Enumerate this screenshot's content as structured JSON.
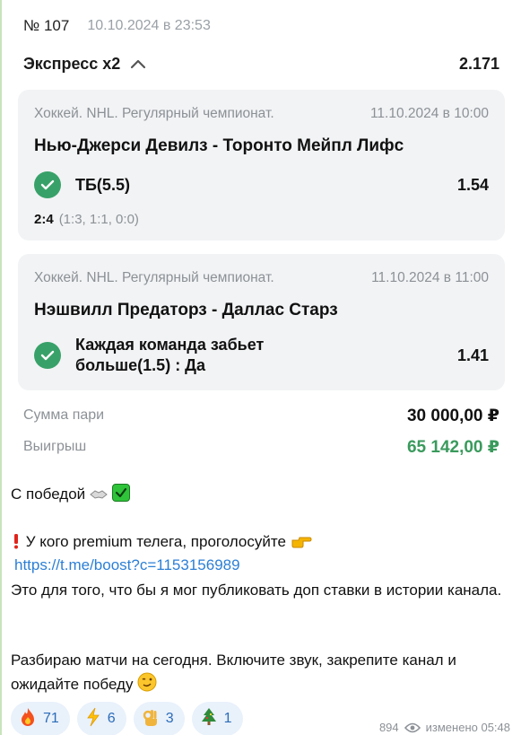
{
  "bet": {
    "number": "№ 107",
    "datetime": "10.10.2024 в 23:53",
    "type": "Экспресс х2",
    "total_odds": "2.171",
    "legs": [
      {
        "league": "Хоккей. NHL. Регулярный чемпионат.",
        "datetime": "11.10.2024 в 10:00",
        "match": "Нью-Джерси Девилз - Торонто Мейпл Лифс",
        "pick": "ТБ(5.5)",
        "odds": "1.54",
        "score": "2:4",
        "periods": "(1:3, 1:1, 0:0)",
        "status": "won"
      },
      {
        "league": "Хоккей. NHL. Регулярный чемпионат.",
        "datetime": "11.10.2024 в 11:00",
        "match": "Нэшвилл Предаторз - Даллас Старз",
        "pick": "Каждая команда забьет больше(1.5) : Да",
        "odds": "1.41",
        "status": "won"
      }
    ],
    "stake_label": "Сумма пари",
    "stake_value": "30 000,00 ₽",
    "win_label": "Выигрыш",
    "win_value": "65 142,00 ₽"
  },
  "message": {
    "line1": "С победой",
    "line2": "У кого premium телега, проголосуйте",
    "link": "https://t.me/boost?c=1153156989",
    "line3": "Это для того, что бы я мог публиковать доп ставки в истории канала.",
    "line4": "Разбираю матчи на сегодня. Включите звук, закрепите канал и ожидайте победу"
  },
  "reactions": [
    {
      "icon": "fire-emoji",
      "count": "71"
    },
    {
      "icon": "lightning-emoji",
      "count": "6"
    },
    {
      "icon": "ok-hand-emoji",
      "count": "3"
    },
    {
      "icon": "christmas-tree-emoji",
      "count": "1"
    }
  ],
  "footer": {
    "views": "894",
    "edited": "изменено 05:48"
  },
  "colors": {
    "win_green": "#3a9a5c",
    "check_green": "#38a169",
    "link_blue": "#2c7fd6",
    "reaction_bg": "#e9f1fb"
  }
}
